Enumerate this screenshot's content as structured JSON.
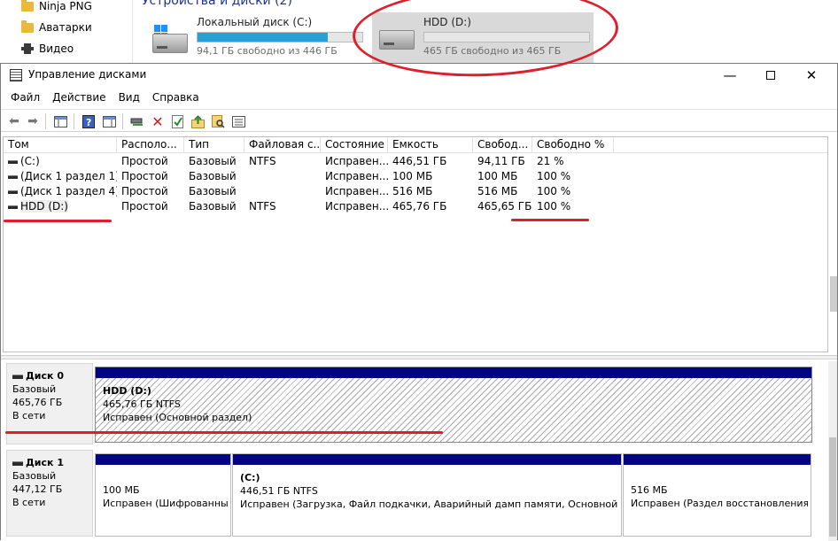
{
  "explorer": {
    "nav_items": [
      {
        "label": "Ninja PNG",
        "icon": "folder-icon"
      },
      {
        "label": "Аватарки",
        "icon": "folder-icon"
      },
      {
        "label": "Видео",
        "icon": "video-icon"
      }
    ],
    "section_header": "Устройства и диски (2)",
    "drives": [
      {
        "name": "Локальный диск (C:)",
        "free_text": "94,1 ГБ свободно из 446 ГБ",
        "used_fraction": 0.79
      },
      {
        "name": "HDD (D:)",
        "free_text": "465 ГБ свободно из 465 ГБ",
        "used_fraction": 0.0
      }
    ]
  },
  "window": {
    "title": "Управление дисками",
    "controls": {
      "minimize": "—",
      "close": "✕"
    }
  },
  "menu": [
    "Файл",
    "Действие",
    "Вид",
    "Справка"
  ],
  "volumes": {
    "columns": [
      "Том",
      "Располо...",
      "Тип",
      "Файловая с...",
      "Состояние",
      "Емкость",
      "Свобод...",
      "Свободно %"
    ],
    "rows": [
      [
        "(C:)",
        "Простой",
        "Базовый",
        "NTFS",
        "Исправен...",
        "446,51 ГБ",
        "94,11 ГБ",
        "21 %"
      ],
      [
        "(Диск 1 раздел 1)",
        "Простой",
        "Базовый",
        "",
        "Исправен...",
        "100 МБ",
        "100 МБ",
        "100 %"
      ],
      [
        "(Диск 1 раздел 4)",
        "Простой",
        "Базовый",
        "",
        "Исправен...",
        "516 МБ",
        "516 МБ",
        "100 %"
      ],
      [
        "HDD (D:)",
        "Простой",
        "Базовый",
        "NTFS",
        "Исправен...",
        "465,76 ГБ",
        "465,65 ГБ",
        "100 %"
      ]
    ]
  },
  "disks": [
    {
      "name": "Диск 0",
      "type": "Базовый",
      "size": "465,76 ГБ",
      "status": "В сети",
      "partitions": [
        {
          "name": "HDD  (D:)",
          "size": "465,76 ГБ NTFS",
          "status": "Исправен (Основной раздел)"
        }
      ]
    },
    {
      "name": "Диск 1",
      "type": "Базовый",
      "size": "447,12 ГБ",
      "status": "В сети",
      "partitions": [
        {
          "name": "",
          "size": "100 МБ",
          "status": "Исправен (Шифрованны"
        },
        {
          "name": "(C:)",
          "size": "446,51 ГБ NTFS",
          "status": "Исправен (Загрузка, Файл подкачки, Аварийный дамп памяти, Основной разд"
        },
        {
          "name": "",
          "size": "516 МБ",
          "status": "Исправен (Раздел восстановления)"
        }
      ]
    }
  ],
  "colors": {
    "annotation": "#e01e2b",
    "partition_header": "#020482",
    "progress": "#26a0da"
  }
}
